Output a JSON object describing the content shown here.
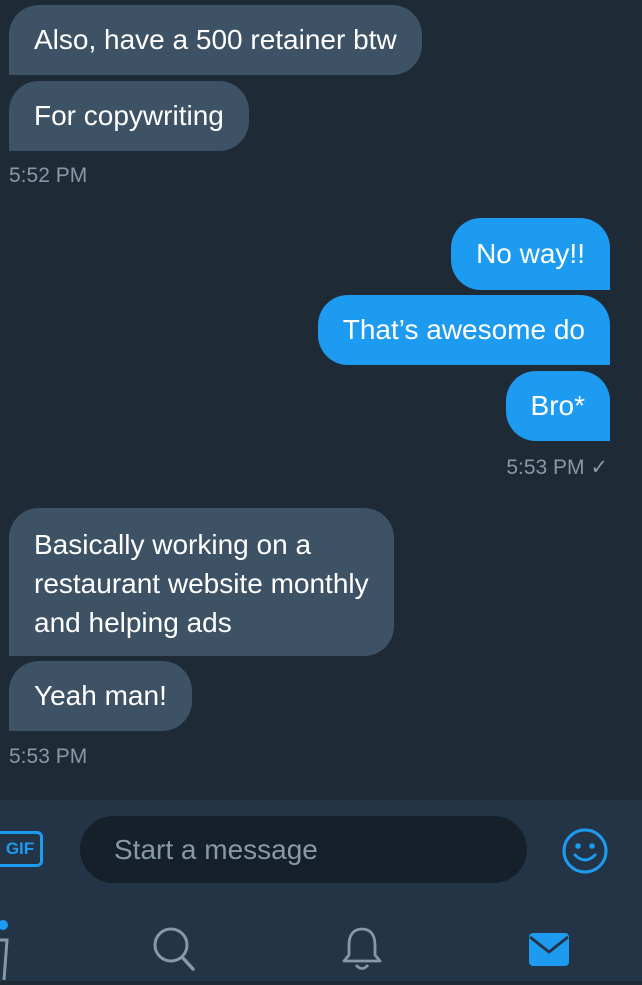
{
  "messages": [
    {
      "text": "Also, have a 500 retainer btw",
      "direction": "incoming"
    },
    {
      "text": "For copywriting",
      "direction": "incoming"
    },
    {
      "timestamp": "5:52 PM"
    },
    {
      "text": "No way!!",
      "direction": "outgoing"
    },
    {
      "text": "That’s awesome do",
      "direction": "outgoing"
    },
    {
      "text": "Bro*",
      "direction": "outgoing"
    },
    {
      "timestamp": "5:53 PM",
      "read_receipt": "✓"
    },
    {
      "text": "Basically working on a\nrestaurant website monthly\nand helping ads",
      "direction": "incoming"
    },
    {
      "text": "Yeah man!",
      "direction": "incoming"
    },
    {
      "timestamp": "5:53 PM"
    }
  ],
  "thread": {
    "msg1": "Also, have a 500 retainer btw",
    "msg2": "For copywriting",
    "ts1": "5:52 PM",
    "msg3": "No way!!",
    "msg4": "That’s awesome do",
    "msg5": "Bro*",
    "ts2": "5:53 PM",
    "read_mark": "✓",
    "msg6_line1": "Basically working on a",
    "msg6_line2": "restaurant website monthly",
    "msg6_line3": "and helping ads",
    "msg7": "Yeah man!",
    "ts3": "5:53 PM"
  },
  "composer": {
    "gif_label": "GIF",
    "placeholder": "Start a message"
  },
  "tabs": [
    {
      "name": "home",
      "icon": "home-icon",
      "active": false
    },
    {
      "name": "search",
      "icon": "search-icon",
      "active": false
    },
    {
      "name": "notifications",
      "icon": "bell-icon",
      "active": false
    },
    {
      "name": "messages",
      "icon": "mail-icon",
      "active": true
    }
  ],
  "colors": {
    "background": "#1f2a37",
    "incoming_bubble": "#3e5266",
    "outgoing_bubble": "#1d9bf0",
    "accent": "#1d9bf0",
    "muted_text": "#8899a6"
  }
}
